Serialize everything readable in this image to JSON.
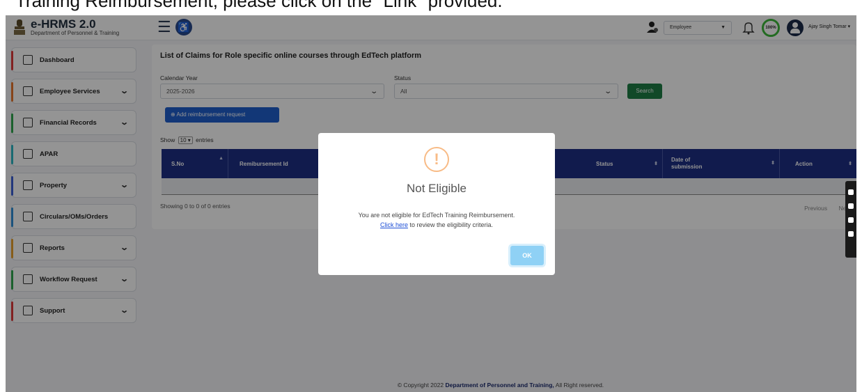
{
  "caption": "Training Reimbursement, please click on the \"Link\" provided.",
  "header": {
    "app_title": "e-HRMS 2.0",
    "app_subtitle": "Department of Personnel & Training",
    "role_value": "Employee",
    "profile_completion": "100%",
    "user_name": "Ajay Singh Tomar"
  },
  "sidebar": {
    "items": [
      {
        "label": "Dashboard",
        "color": "#e03a3a"
      },
      {
        "label": "Employee Services",
        "color": "#e8762c"
      },
      {
        "label": "Financial Records",
        "color": "#2fa84f"
      },
      {
        "label": "APAR",
        "color": "#2cb7c4"
      },
      {
        "label": "Property",
        "color": "#3b5fd6"
      },
      {
        "label": "Circulars/OMs/Orders",
        "color": "#2f8fd8"
      },
      {
        "label": "Reports",
        "color": "#e8a12c"
      },
      {
        "label": "Workflow Request",
        "color": "#2fa84f"
      },
      {
        "label": "Support",
        "color": "#e03a3a"
      }
    ]
  },
  "main": {
    "title": "List of Claims for Role specific online courses through EdTech platform",
    "calendar_year_label": "Calendar Year",
    "calendar_year_value": "2025-2026",
    "status_label": "Status",
    "status_value": "All",
    "search_label": "Search",
    "add_label": "Add reimbursement request",
    "show_prefix": "Show",
    "show_value": "10",
    "show_suffix": "entries",
    "columns": [
      "S.No",
      "Remibursement Id",
      "Status",
      "Date of submission",
      "Action"
    ],
    "showing_text": "Showing 0 to 0 of 0 entries",
    "prev_label": "Previous",
    "next_label": "Next"
  },
  "footer": {
    "prefix": "© Copyright 2022",
    "org": "Department of Personnel and Training,",
    "suffix": "All Right reserved."
  },
  "modal": {
    "icon": "!",
    "title": "Not Eligible",
    "message": "You are not eligible for EdTech Training Reimbursement.",
    "link_text": "Click here",
    "link_suffix": "to review the eligibility criteria.",
    "ok_label": "OK"
  }
}
